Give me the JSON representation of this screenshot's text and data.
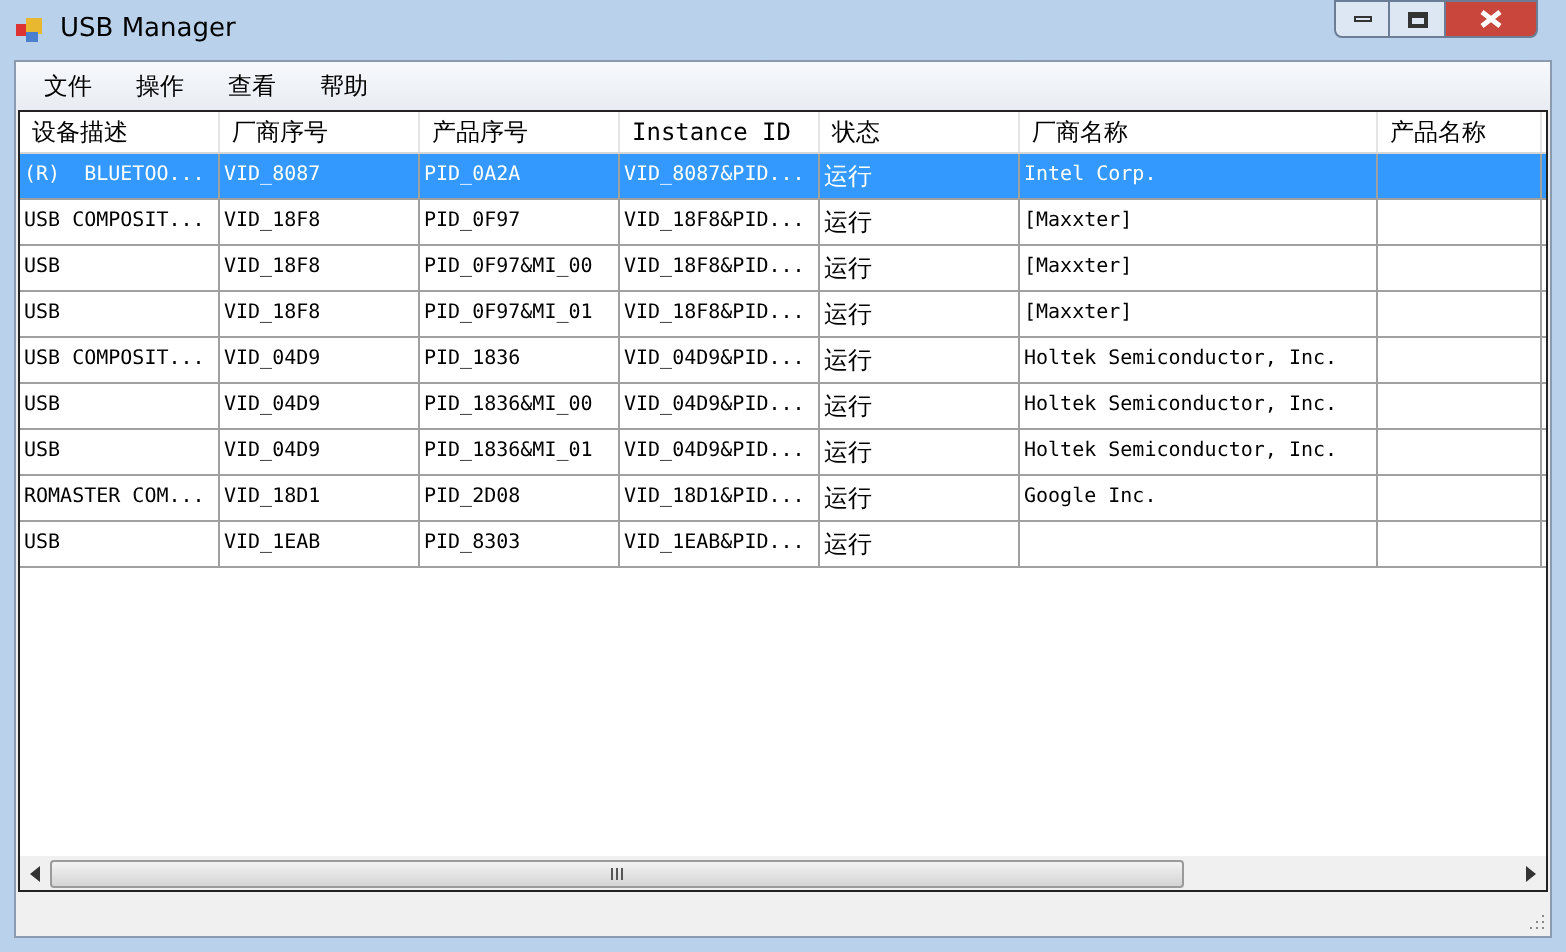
{
  "window": {
    "title": "USB Manager"
  },
  "menu": [
    "文件",
    "操作",
    "查看",
    "帮助"
  ],
  "table": {
    "columns": [
      "设备描述",
      "厂商序号",
      "产品序号",
      "Instance ID",
      "状态",
      "厂商名称",
      "产品名称"
    ],
    "rows": [
      {
        "selected": true,
        "cells": [
          "(R)  BLUETOO...",
          "VID_8087",
          "PID_0A2A",
          "VID_8087&PID...",
          "运行",
          "Intel Corp.",
          ""
        ]
      },
      {
        "selected": false,
        "cells": [
          "USB COMPOSIT...",
          "VID_18F8",
          "PID_0F97",
          "VID_18F8&PID...",
          "运行",
          "[Maxxter]",
          ""
        ]
      },
      {
        "selected": false,
        "cells": [
          "USB",
          "VID_18F8",
          "PID_0F97&MI_00",
          "VID_18F8&PID...",
          "运行",
          "[Maxxter]",
          ""
        ]
      },
      {
        "selected": false,
        "cells": [
          "USB",
          "VID_18F8",
          "PID_0F97&MI_01",
          "VID_18F8&PID...",
          "运行",
          "[Maxxter]",
          ""
        ]
      },
      {
        "selected": false,
        "cells": [
          "USB COMPOSIT...",
          "VID_04D9",
          "PID_1836",
          "VID_04D9&PID...",
          "运行",
          "Holtek Semiconductor, Inc.",
          ""
        ]
      },
      {
        "selected": false,
        "cells": [
          "USB",
          "VID_04D9",
          "PID_1836&MI_00",
          "VID_04D9&PID...",
          "运行",
          "Holtek Semiconductor, Inc.",
          ""
        ]
      },
      {
        "selected": false,
        "cells": [
          "USB",
          "VID_04D9",
          "PID_1836&MI_01",
          "VID_04D9&PID...",
          "运行",
          "Holtek Semiconductor, Inc.",
          ""
        ]
      },
      {
        "selected": false,
        "cells": [
          "ROMASTER COM...",
          "VID_18D1",
          "PID_2D08",
          "VID_18D1&PID...",
          "运行",
          "Google Inc.",
          ""
        ]
      },
      {
        "selected": false,
        "cells": [
          "USB",
          "VID_1EAB",
          "PID_8303",
          "VID_1EAB&PID...",
          "运行",
          "",
          ""
        ]
      }
    ]
  }
}
